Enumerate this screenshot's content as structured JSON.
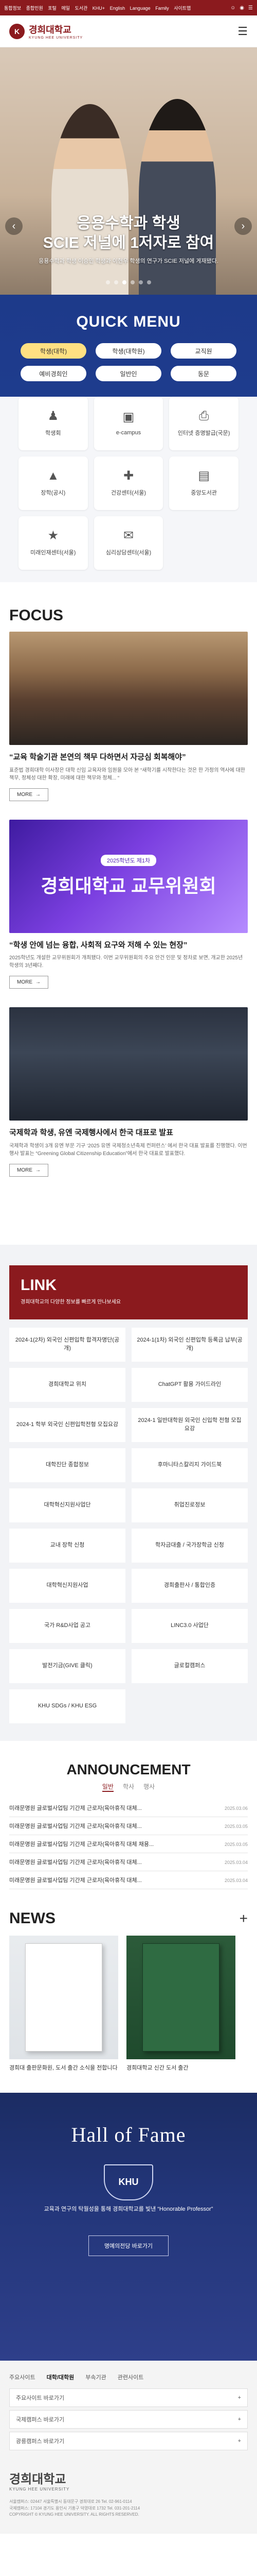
{
  "topbar": {
    "links": [
      "통합정보",
      "종합민원",
      "포털",
      "메일",
      "도서관",
      "KHU+",
      "English",
      "Language",
      "Family",
      "사이트맵"
    ],
    "icons": [
      "profile-icon",
      "globe-icon",
      "sitemap-icon"
    ]
  },
  "header": {
    "logo_mark": "K",
    "logo_text": "경희대학교",
    "logo_sub": "KYUNG HEE UNIVERSITY",
    "menu_icon": "hamburger-icon"
  },
  "hero": {
    "title_line1": "응용수학과 학생",
    "title_line2": "SCIE 저널에 1저자로 참여",
    "desc": "응용수학과 학생 이승민 학생과 이현우 학생의 연구가 SCIE 저널에 게재됐다.",
    "dots": 6,
    "active_dot": 2
  },
  "quick_menu": {
    "title": "QUICK MENU",
    "tabs": [
      {
        "label": "학생(대학)",
        "active": true
      },
      {
        "label": "학생(대학원)",
        "active": false
      },
      {
        "label": "교직원",
        "active": false
      },
      {
        "label": "예비경희인",
        "active": false
      },
      {
        "label": "일반인",
        "active": false
      },
      {
        "label": "동문",
        "active": false
      }
    ],
    "items": [
      {
        "label": "학생회",
        "icon": "group-icon"
      },
      {
        "label": "e-campus",
        "icon": "laptop-icon"
      },
      {
        "label": "인터넷 증명발급(국문)",
        "icon": "printer-icon"
      },
      {
        "label": "장학(공시)",
        "icon": "graduation-cap-icon"
      },
      {
        "label": "건강센터(서울)",
        "icon": "health-icon"
      },
      {
        "label": "중앙도서관",
        "icon": "book-icon"
      },
      {
        "label": "미래인재센터(서울)",
        "icon": "career-icon"
      },
      {
        "label": "심리상담센터(서울)",
        "icon": "chat-icon"
      }
    ]
  },
  "focus": {
    "title": "FOCUS",
    "cards": [
      {
        "title": "“교육 학술기관 본연의 책무 다하면서 자긍심 회복해야”",
        "desc": "표준법 경희대학 이사장은 대학 신임 교육자와 임원을 모아 본 “새학기를 시작한다는 것은 한 가정의 역사에 대한 책무, 정체성 대한 확장, 미래에 대한 책무와 정체... “",
        "more": "MORE"
      },
      {
        "title": "“학생 안에 넘는 융합, 사회적 요구와 저해 수 있는 현장”",
        "desc": "2025학년도 개설한 교무위원회가 개최됐다. 이번 교무위원회의 주요 안건 인문 및 정차로 보면, 개교한 2025년 학생의 3년째다.",
        "more": "MORE",
        "img_chip": "2025학년도 제1차",
        "img_text": "경희대학교 교무위원회"
      },
      {
        "title": "국제학과 학생, 유엔 국제행사에서 한국 대표로 발표",
        "desc": "국제학과 학생이 3개 유엔 부문 기구 ‘2025 유엔 국제청소년축제 컨퍼런스’ 에서 한국 대표 발표를 진행했다. 이번 행사 발표는 “Greening Global Citizenship Education”에서 한국 대표로 발표했다.",
        "more": "MORE"
      }
    ]
  },
  "link": {
    "title": "LINK",
    "subtitle": "경희대학교의 다양한 정보를 빠르게 만나보세요",
    "items": [
      "2024-1(2차) 외국인 신편입학 합격자명단(공개)",
      "2024-1(1차) 외국인 신편입학 등록금 납부(공개)",
      "경희대학교 위치",
      "ChatGPT 활용 가이드라인",
      "2024-1 학부 외국인 신편입학전형 모집요강",
      "2024-1 일반대학원 외국인 신입학 전형 모집요강",
      "대학진단 종합정보",
      "후마니타스칼리지 가이드북",
      "대학혁신지원사업단",
      "취업진로정보",
      "교내 장학 신청",
      "학자금대출 / 국가장학금 신청",
      "대학혁신지원사업",
      "경희출판사 / 통합인증",
      "국가 R&D사업 공고",
      "LINC3.0 사업단",
      "발전기금(GIVE 클릭)",
      "글로컬캠퍼스",
      "KHU SDGs / KHU ESG"
    ]
  },
  "announce": {
    "title": "ANNOUNCEMENT",
    "tabs": [
      {
        "label": "일반",
        "active": true
      },
      {
        "label": "학사",
        "active": false
      },
      {
        "label": "행사",
        "active": false
      }
    ],
    "rows": [
      {
        "title": "미래문명원 글로벌사업팀 기간제 근로자(육아휴직 대체...",
        "date": "2025.03.06"
      },
      {
        "title": "미래문명원 글로벌사업팀 기간제 근로자(육아휴직 대체...",
        "date": "2025.03.05"
      },
      {
        "title": "미래문명원 글로벌사업팀 기간제 근로자(육아휴직 대체 채용...",
        "date": "2025.03.05"
      },
      {
        "title": "미래문명원 글로벌사업팀 기간제 근로자(육아휴직 대체...",
        "date": "2025.03.04"
      },
      {
        "title": "미래문명원 글로벌사업팀 기간제 근로자(육아휴직 대체...",
        "date": "2025.03.04"
      }
    ]
  },
  "news": {
    "title": "NEWS",
    "cards": [
      {
        "title": "경희대 출판문화원, 도서 출간 소식을 전합니다"
      },
      {
        "title": "경희대학교 신간 도서 출간"
      }
    ]
  },
  "hall": {
    "title": "Hall of Fame",
    "emblem": "KHU",
    "desc": "교육과 연구의 탁월성을 통해 경희대학교를 빛낸 “Honorable Professor”",
    "button": "명예의전당 바로가기"
  },
  "footer": {
    "tabs": [
      {
        "label": "주요사이트",
        "active": false
      },
      {
        "label": "대학/대학원",
        "active": true
      },
      {
        "label": "부속기관",
        "active": false
      },
      {
        "label": "관련사이트",
        "active": false
      }
    ],
    "selects": [
      "주요사이트 바로가기",
      "국제캠퍼스 바로가기",
      "광릉캠퍼스 바로가기"
    ],
    "logo_text": "경희대학교",
    "logo_sub": "KYUNG HEE UNIVERSITY",
    "info_line1": "서울캠퍼스: 02447 서울특별시 동대문구 경희대로 26 Tel. 02-961-0114",
    "info_line2": "국제캠퍼스: 17104 경기도 용인시 기흥구 덕영대로 1732 Tel. 031-201-2114",
    "info_line3": "COPYRIGHT © KYUNG HEE UNIVERSITY. ALL RIGHTS RESERVED."
  },
  "colors": {
    "brand": "#8b1a1e",
    "quick_bg": "#1d3a8a",
    "hall_bg": "#23367a",
    "tab_active": "#ffe082"
  }
}
